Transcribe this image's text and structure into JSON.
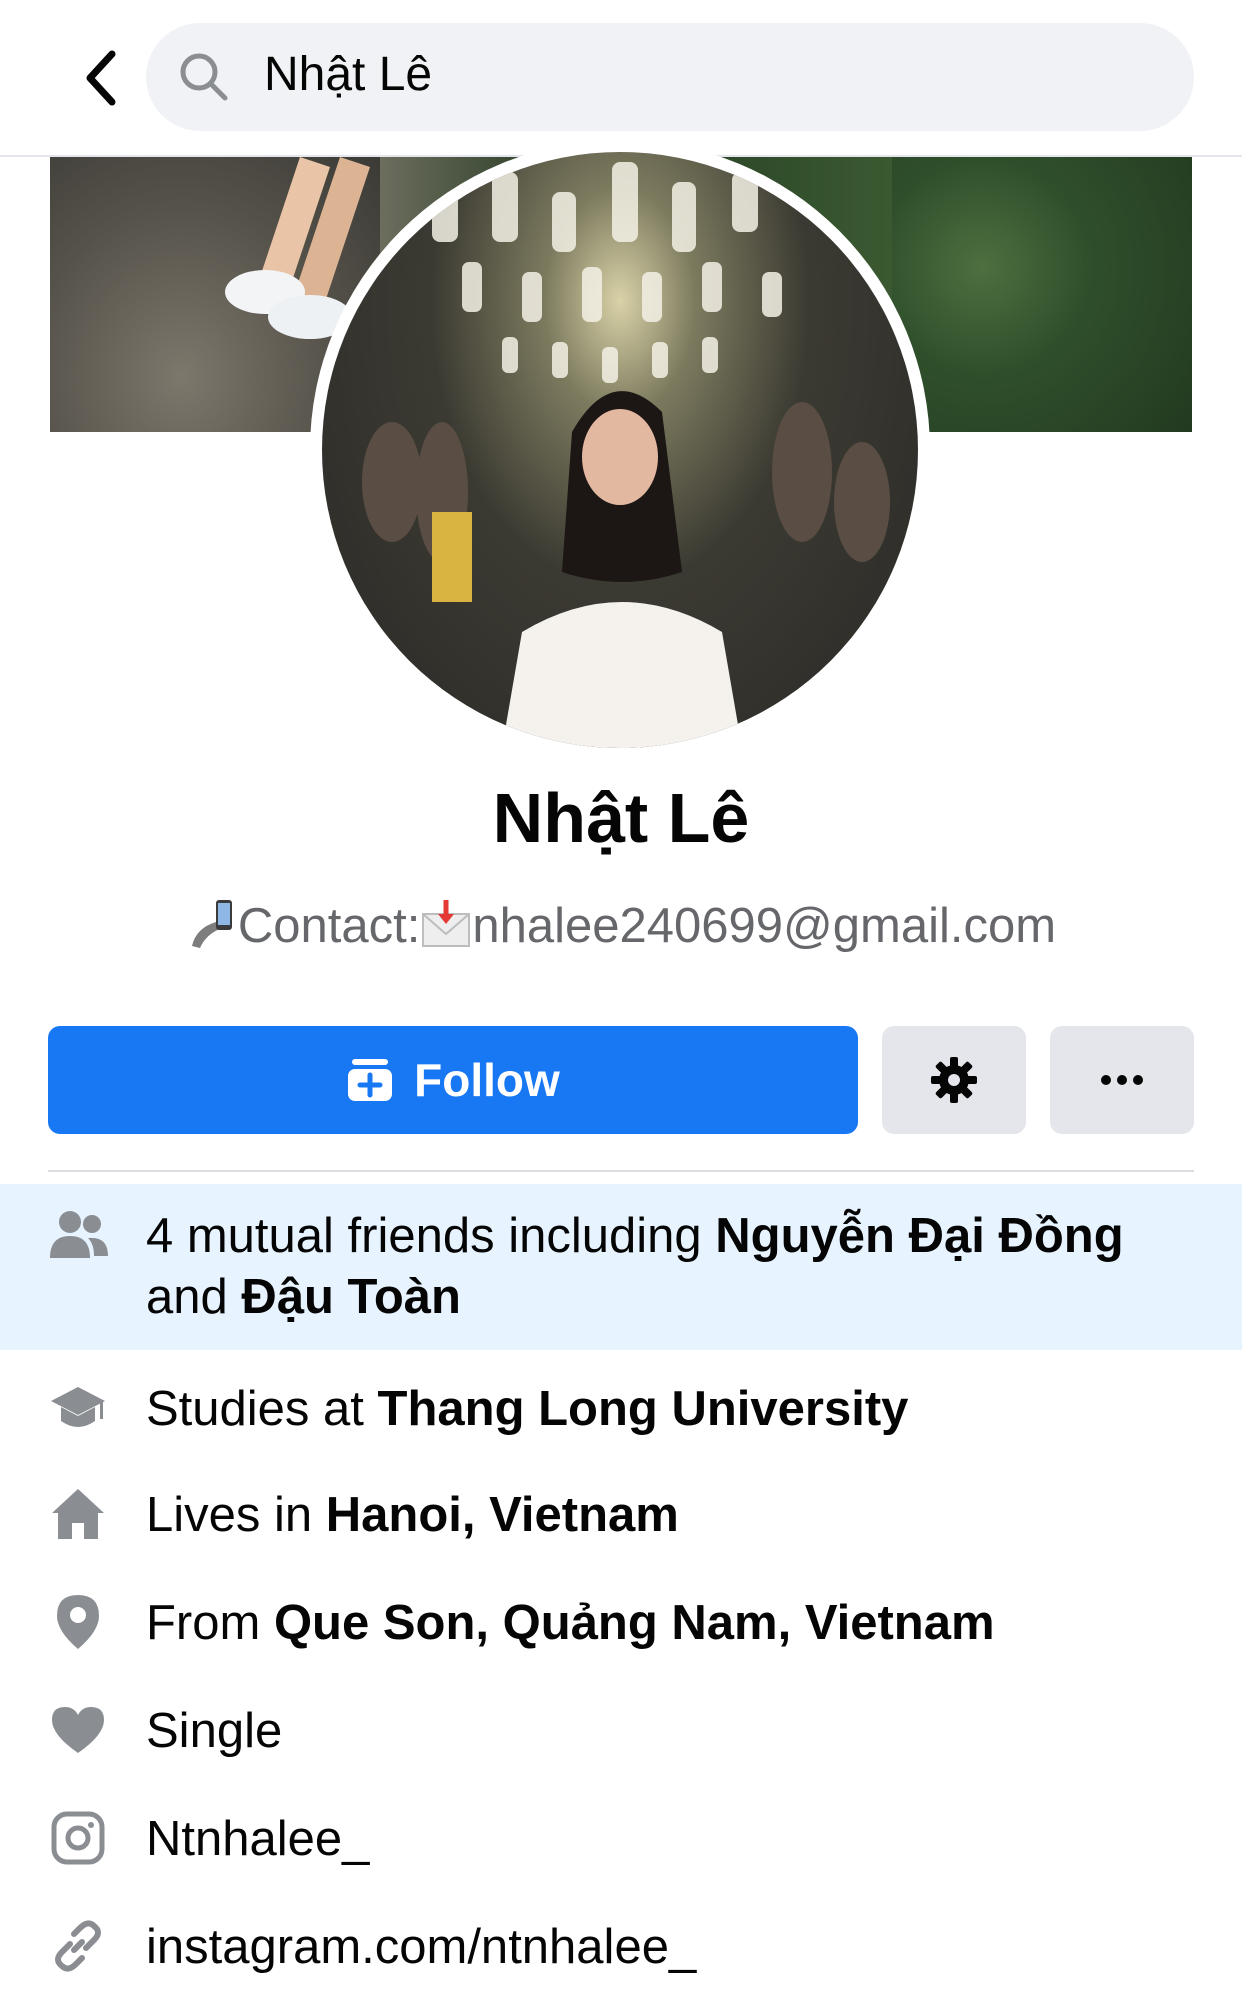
{
  "search": {
    "query": "Nhật Lê"
  },
  "profile": {
    "name": "Nhật Lê",
    "bio": {
      "label": "Contact:",
      "email": "nhalee240699@gmail.com"
    }
  },
  "actions": {
    "follow_label": "Follow"
  },
  "mutual": {
    "prefix": "4 mutual friends including ",
    "friend1": "Nguyễn Đại Đồng",
    "joiner": " and ",
    "friend2": "Đậu Toàn"
  },
  "details": {
    "studies": {
      "prefix": "Studies at ",
      "value": "Thang Long University"
    },
    "lives": {
      "prefix": "Lives in ",
      "value": "Hanoi, Vietnam"
    },
    "from": {
      "prefix": "From ",
      "value": "Que Son, Quảng Nam, Vietnam"
    },
    "relationship": "Single",
    "instagram": "Ntnhalee_",
    "website": "instagram.com/ntnhalee_"
  },
  "colors": {
    "accent": "#1877f2",
    "icon_gray": "#8a8d91",
    "highlight_bg": "#e7f3ff"
  },
  "icons": [
    "chevron-left-icon",
    "search-icon",
    "phone-emoji-icon",
    "envelope-emoji-icon",
    "follow-icon",
    "gear-icon",
    "more-icon",
    "friends-icon",
    "graduation-cap-icon",
    "home-icon",
    "location-pin-icon",
    "heart-icon",
    "instagram-icon",
    "link-icon"
  ]
}
